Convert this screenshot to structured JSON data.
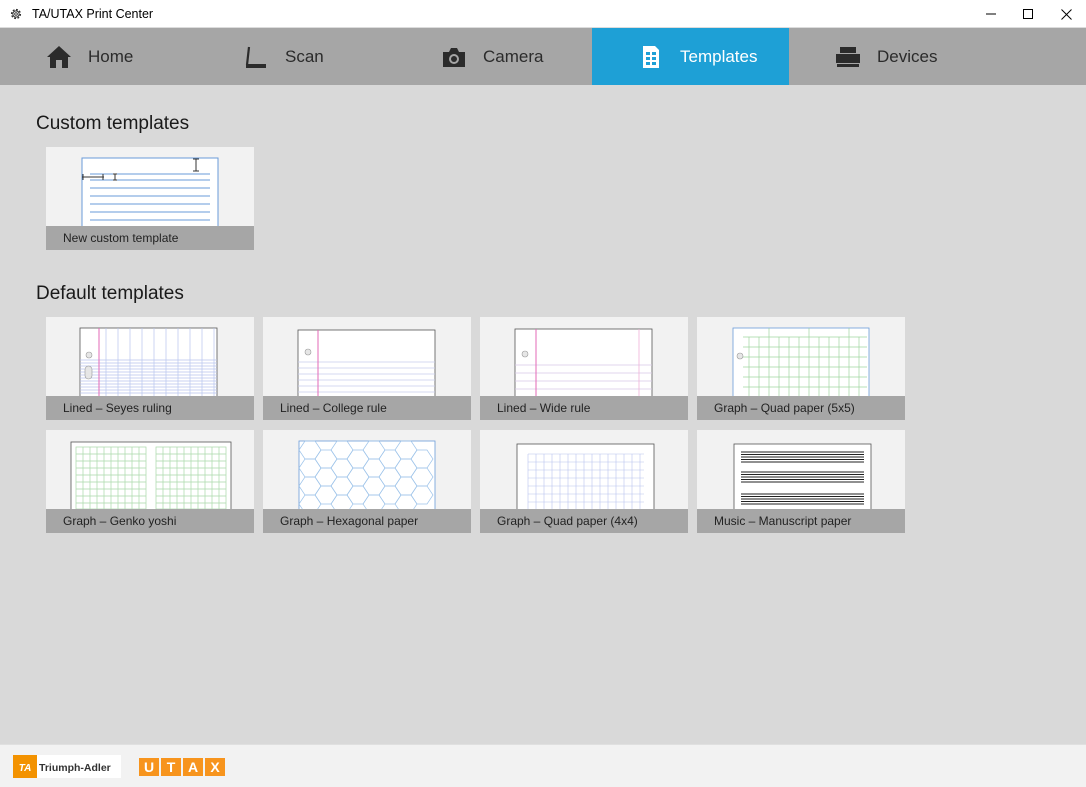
{
  "window": {
    "title": "TA/UTAX Print Center"
  },
  "nav": {
    "tabs": [
      {
        "label": "Home",
        "icon": "home-icon",
        "active": false
      },
      {
        "label": "Scan",
        "icon": "scan-icon",
        "active": false
      },
      {
        "label": "Camera",
        "icon": "camera-icon",
        "active": false
      },
      {
        "label": "Templates",
        "icon": "templates-icon",
        "active": true
      },
      {
        "label": "Devices",
        "icon": "printer-icon",
        "active": false
      }
    ]
  },
  "custom": {
    "title": "Custom templates",
    "items": [
      {
        "label": "New custom template"
      }
    ]
  },
  "defaults": {
    "title": "Default templates",
    "items": [
      {
        "label": "Lined – Seyes ruling"
      },
      {
        "label": "Lined – College rule"
      },
      {
        "label": "Lined – Wide rule"
      },
      {
        "label": "Graph – Quad paper (5x5)"
      },
      {
        "label": "Graph – Genko yoshi"
      },
      {
        "label": "Graph – Hexagonal paper"
      },
      {
        "label": "Graph – Quad paper (4x4)"
      },
      {
        "label": "Music – Manuscript paper"
      }
    ]
  },
  "footer": {
    "logo_ta_mark": "TA",
    "logo_ta_text": "Triumph-Adler",
    "logo_utax_letters": [
      "U",
      "T",
      "A",
      "X"
    ]
  },
  "colors": {
    "accent": "#1ea0d6",
    "nav_bg": "#a6a6a6",
    "content_bg": "#d9d9d9",
    "ta_orange": "#f39200",
    "utax_orange": "#f7941d"
  }
}
